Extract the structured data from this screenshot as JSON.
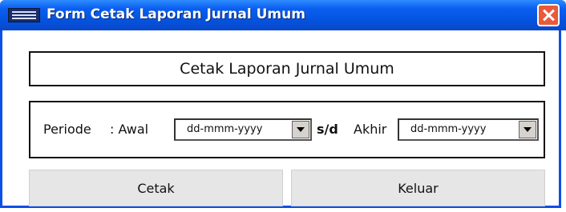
{
  "window": {
    "title": "Form Cetak Laporan Jurnal Umum",
    "title_icon": "form-icon",
    "close_icon": "close-icon"
  },
  "header": {
    "text": "Cetak Laporan Jurnal Umum"
  },
  "period": {
    "label": "Periode",
    "colon_awal": ": Awal",
    "awal_value": "dd-mmm-yyyy",
    "separator": "s/d",
    "akhir_label": "Akhir",
    "akhir_value": "dd-mmm-yyyy"
  },
  "buttons": {
    "cetak": "Cetak",
    "keluar": "Keluar"
  },
  "colors": {
    "titlebar": "#0452dd",
    "close": "#e85a3a",
    "button_bg": "#e6e6e6"
  }
}
